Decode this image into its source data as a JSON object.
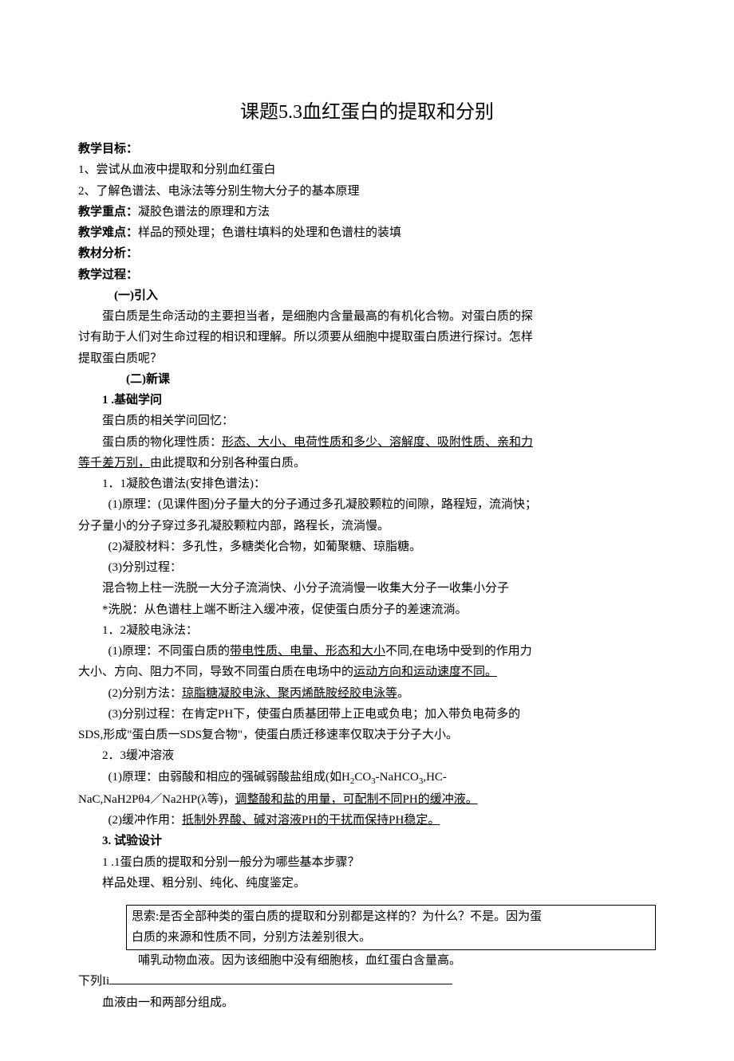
{
  "title": "课题5.3血红蛋白的提取和分别",
  "head_goal": "教学目标：",
  "goal1": "1、尝试从血液中提取和分别血红蛋白",
  "goal2": "2、了解色谱法、电泳法等分别生物大分子的基本原理",
  "head_keypoint_label": "教学重点：",
  "head_keypoint_text": "凝胶色谱法的原理和方法",
  "head_diff_label": "教学难点：",
  "head_diff_text": "样品的预处理；色谱柱填料的处理和色谱柱的装填",
  "head_analysis": "教材分析：",
  "head_process": "教学过程：",
  "sec1_head": "(一)引入",
  "sec1_p1a": "蛋白质是生命活动的主要担当者，是细胞内含量最高的有机化合物。对蛋白质的探",
  "sec1_p1b": "讨有助于人们对生命过程的相识和理解。所以须要从细胞中提取蛋白质进行探讨。怎样",
  "sec1_p1c": "提取蛋白质呢？",
  "sec2_head": "(二)新课",
  "sec2_1": "1 .基础学问",
  "sec2_1a": "蛋白质的相关学问回忆：",
  "sec2_1b_pre": "蛋白质的物化理性质：",
  "sec2_1b_u": "形态、大小、电荷性质和多少、溶解度、吸附性质、亲和力",
  "sec2_1b_u2": "等千差万别，",
  "sec2_1b_post": "由此提取和分别各种蛋白质。",
  "sec2_11": "1．1凝胶色谱法(安排色谱法)：",
  "sec2_11_p1a": "(1)原理：(见课件图)分子量大的分子通过多孔凝胶颗粒的间隙，路程短，流淌快；",
  "sec2_11_p1b": "分子量小的分子穿过多孔凝胶颗粒内部，路程长，流淌慢。",
  "sec2_11_p2": "(2)凝胶材料：多孔性，多糖类化合物，如葡聚糖、琼脂糖。",
  "sec2_11_p3": "(3)分别过程：",
  "sec2_11_p3a": "混合物上柱一洗脱一大分子流淌快、小分子流淌慢一收集大分子一收集小分子",
  "sec2_11_p3b": "*洗脱：从色谱柱上端不断注入缓冲液，促使蛋白质分子的差速流淌。",
  "sec2_12": "1．2凝胶电泳法：",
  "sec2_12_p1_pre": "(1)原理：不同蛋白质的",
  "sec2_12_p1_u1": "带电性质、电量、形态和大小",
  "sec2_12_p1_mid": "不同,在电场中受到的作用力",
  "sec2_12_p1b_pre": "大小、方向、阻力不同，导致不同蛋白质在电场中的",
  "sec2_12_p1b_u": "运动方向和运动速度不同。",
  "sec2_12_p2_pre": "(2)分别方法：",
  "sec2_12_p2_u": "琼脂糖凝胶电泳、聚丙烯酰胺经胶电泳等",
  "sec2_12_p2_post": "。",
  "sec2_12_p3a": "(3)分别过程：在肯定PH下，使蛋白质基团带上正电或负电；加入带负电荷多的",
  "sec2_12_p3b": "SDS,形成\"蛋白质一SDS复合物\"，使蛋白质迁移速率仅取决于分子大小。",
  "sec2_23": "2．3缓冲溶液",
  "sec2_23_p1_pre": "(1)原理：由弱酸和相应的强碱弱酸盐组成(如H",
  "sec2_23_p1_co3": "CO",
  "sec2_23_p1_nahco3": "-NaHCO",
  "sec2_23_p1_hc": ",HC-",
  "sec2_23_p1b_pre": "NaC,NaH2Pθ4／Na2HP(λ等)，",
  "sec2_23_p1b_u": "调整酸和盐的用量，可配制不同PH的缓冲液。",
  "sec2_23_p2_pre": "(2)缓冲作用：",
  "sec2_23_p2_u": "抵制外界酸、碱对溶液PH的干扰而保持PH稳定。",
  "sec3": "3. 试验设计",
  "sec3_1": "1 .1蛋白质的提取和分别一般分为哪些基本步骤？",
  "sec3_1a": "样品处理、粗分别、纯化、纯度鉴定。",
  "box_line1": "思索:是否全部种类的蛋白质的提取和分别都是这样的？为什么？不是。因为蛋",
  "box_line2": "白质的来源和性质不同，分别方法差别很大。",
  "after_box": "哺乳动物血液。因为该细胞中没有细胞核，血红蛋白含量高。",
  "bottom_label": "下列Ii",
  "last_line": "血液由一和两部分组成。"
}
